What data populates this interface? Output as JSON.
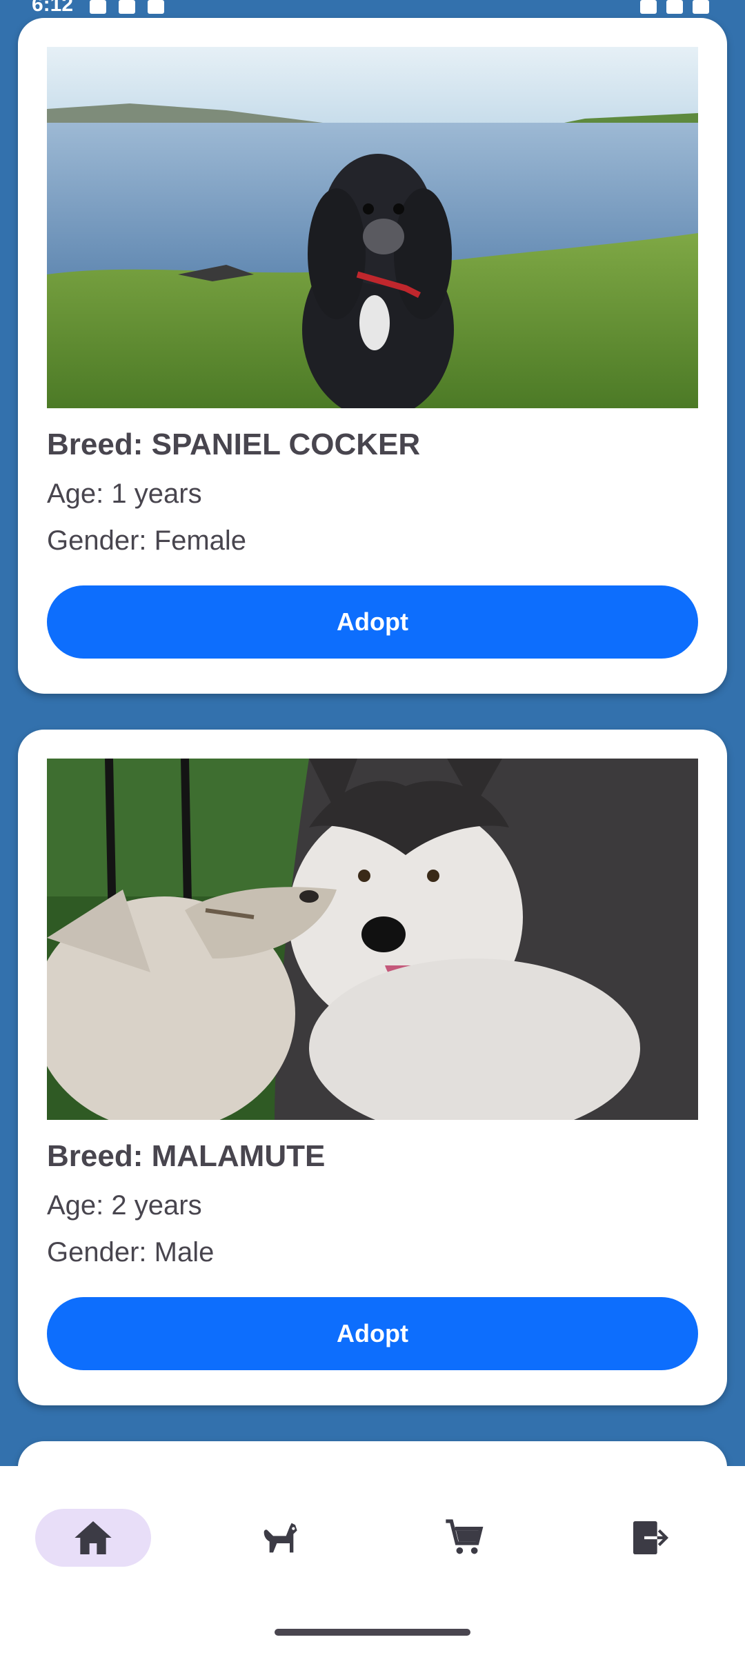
{
  "status_bar": {
    "time": "6:12"
  },
  "pets": [
    {
      "breed": "Breed: SPANIEL COCKER",
      "age": "Age: 1 years",
      "gender": "Gender: Female",
      "adopt_label": "Adopt"
    },
    {
      "breed": "Breed: MALAMUTE",
      "age": "Age: 2 years",
      "gender": "Gender: Male",
      "adopt_label": "Adopt"
    }
  ],
  "bottom_nav": {
    "items": [
      {
        "icon": "home-icon",
        "active": true
      },
      {
        "icon": "dog-icon",
        "active": false
      },
      {
        "icon": "cart-icon",
        "active": false
      },
      {
        "icon": "logout-icon",
        "active": false
      }
    ]
  },
  "colors": {
    "background": "#3371AD",
    "card": "#FFFFFF",
    "button": "#0D6EFD",
    "text": "#48454E",
    "nav_active_pill": "#E8DEF8",
    "nav_icon": "#3C3B45"
  }
}
